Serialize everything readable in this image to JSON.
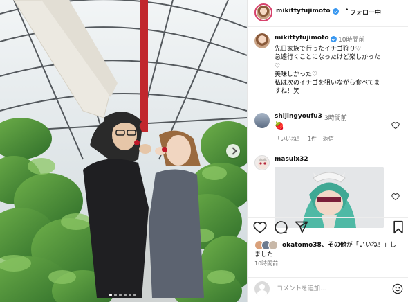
{
  "header": {
    "username": "mikittyfujimoto",
    "separator": "•",
    "follow_state": "フォロー中"
  },
  "caption": {
    "username": "mikittyfujimoto",
    "time": "10時間前",
    "lines": [
      "先日家族で行ったイチゴ狩り♡",
      "急遽行くことになったけど楽しかった",
      "♡",
      "美味しかった♡",
      "私は次のイチゴを狙いながら食べてま",
      "すね！笑"
    ]
  },
  "comments": [
    {
      "username": "shijingyoufu3",
      "time": "3時間前",
      "body_emoji": "🍓",
      "likes_label": "「いいね！」1件",
      "reply_label": "返信"
    },
    {
      "username": "masuix32",
      "sticker": "anime-character-sticker"
    }
  ],
  "likes": {
    "liker": "okatomo38",
    "text_mid": "、その他",
    "text_after": "が「いいね！」し",
    "text_line2": "ました"
  },
  "post_time": "10時間前",
  "comment_box": {
    "placeholder": "コメントを追加..."
  },
  "icons": {
    "like": "heart-icon",
    "comment": "comment-icon",
    "share": "share-icon",
    "save": "bookmark-icon",
    "emoji": "emoji-icon",
    "next": "chevron-right-icon"
  },
  "colors": {
    "verified": "#3897f0",
    "story_ring": "#d7416b",
    "secondary_text": "#737373"
  }
}
